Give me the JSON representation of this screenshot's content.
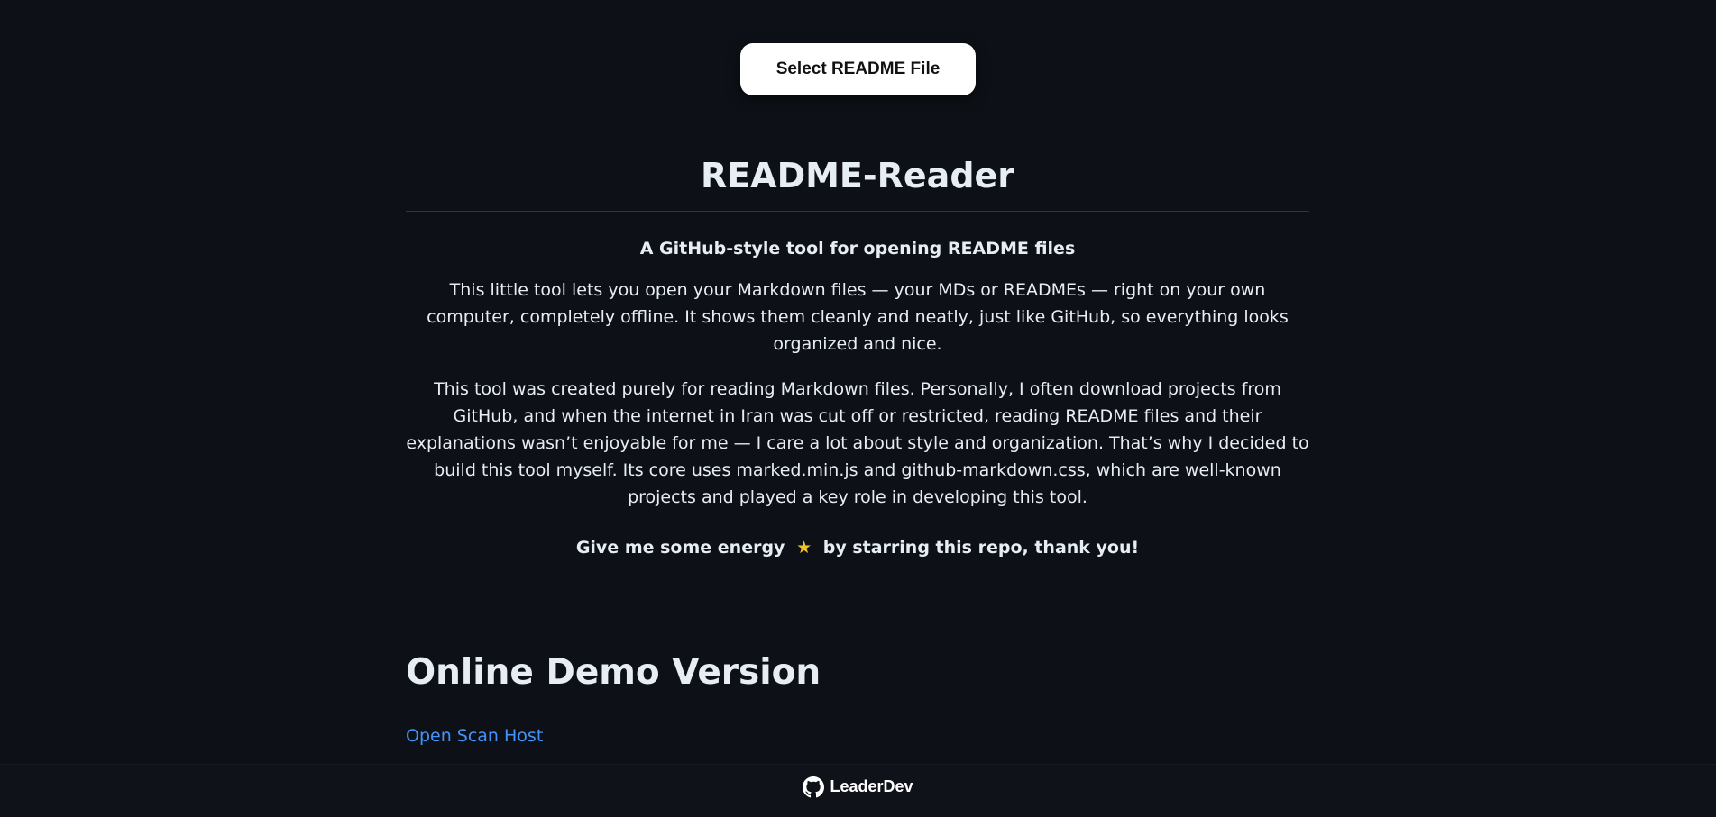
{
  "toolbar": {
    "select_button_label": "Select README File"
  },
  "readme": {
    "title": "README-Reader",
    "subtitle": "A GitHub-style tool for opening README files",
    "paragraph_1": "This little tool lets you open your Markdown files — your MDs or READMEs — right on your own computer, completely offline. It shows them cleanly and neatly, just like GitHub, so everything looks organized and nice.",
    "paragraph_2": "This tool was created purely for reading Markdown files. Personally, I often download projects from GitHub, and when the internet in Iran was cut off or restricted, reading README files and their explanations wasn’t enjoyable for me — I care a lot about style and organization. That’s why I decided to build this tool myself. Its core uses marked.min.js and github-markdown.css, which are well-known projects and played a key role in developing this tool.",
    "energy_before": "Give me some energy",
    "energy_icon": "star-icon",
    "energy_after": "by starring this repo, thank you!",
    "section_title": "Online Demo Version",
    "demo_link_label": "Open Scan Host"
  },
  "footer": {
    "brand_label": "LeaderDev",
    "brand_icon": "github-icon"
  },
  "colors": {
    "background": "#0d1117",
    "text": "#e6edf3",
    "link": "#4493f8",
    "star": "#f2c12e",
    "border": "#30363d"
  }
}
